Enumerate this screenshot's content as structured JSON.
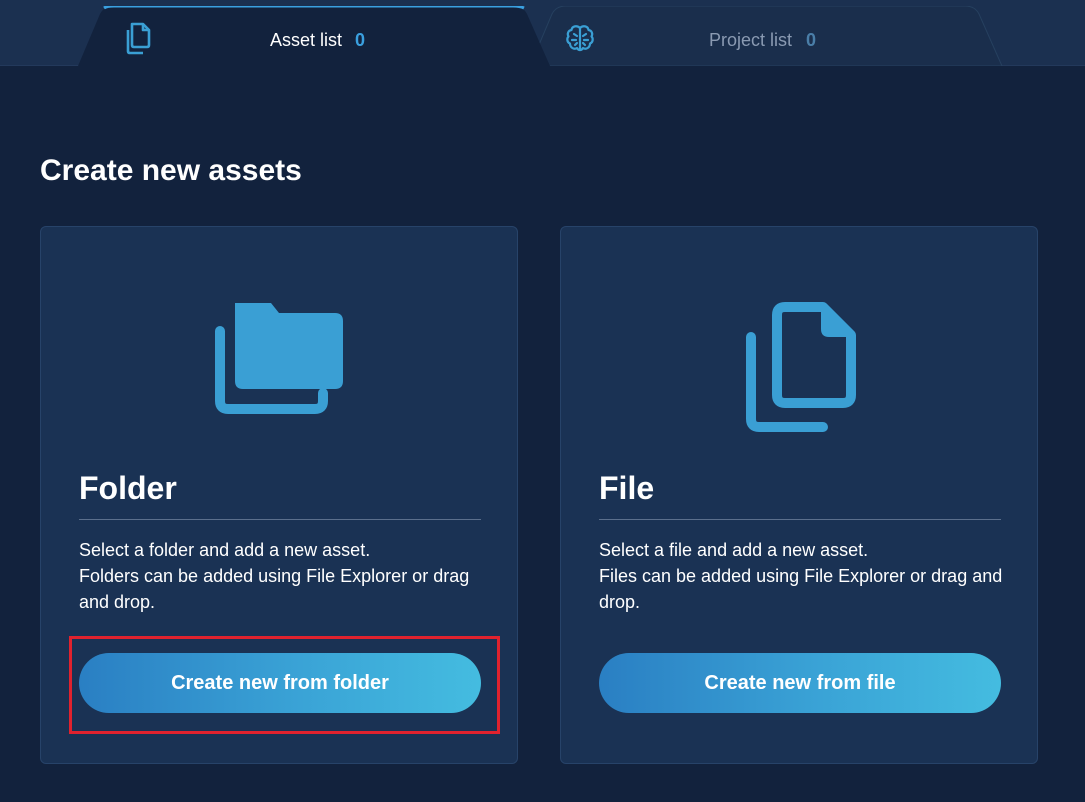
{
  "tabs": [
    {
      "label": "Asset list",
      "count": "0",
      "icon": "copy-icon",
      "active": true
    },
    {
      "label": "Project list",
      "count": "0",
      "icon": "brain-icon",
      "active": false
    }
  ],
  "main": {
    "title": "Create new assets",
    "cards": [
      {
        "title": "Folder",
        "icon": "folder-copy-icon",
        "desc_line1": "Select a folder and add a new asset.",
        "desc_line2": "Folders can be added using File Explorer or drag and drop.",
        "button_label": "Create new from folder"
      },
      {
        "title": "File",
        "icon": "file-copy-icon",
        "desc_line1": "Select a file and add a new asset.",
        "desc_line2": "Files can be added using File Explorer or drag and drop.",
        "button_label": "Create new from file"
      }
    ]
  },
  "colors": {
    "background": "#12223d",
    "card": "#1a3254",
    "accent": "#3aa0e0",
    "icon": "#3a9fd4",
    "highlight": "#e0222e"
  }
}
